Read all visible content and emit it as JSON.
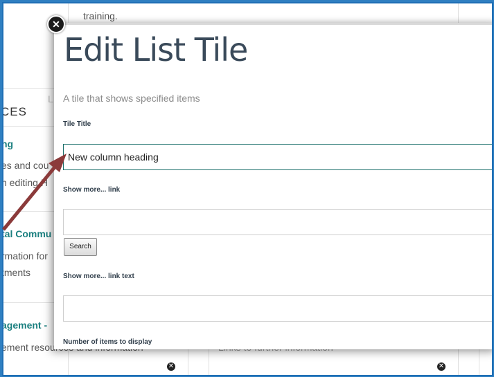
{
  "background": {
    "top_text": "training.",
    "section_heading": "CES",
    "link_1": "ng",
    "text_1": "es and cou",
    "text_2": "n editing H",
    "link_2": "tal Commu",
    "text_3": "rmation for",
    "text_4": "tments",
    "link_3": "agement - ",
    "text_5": "ement resources and information",
    "text_6": "Links to further information",
    "faint_char": "L"
  },
  "modal": {
    "close_icon": "close-icon",
    "title": "Edit List Tile",
    "description": "A tile that shows specified items",
    "fields": {
      "tile_title_label": "Tile Title",
      "tile_title_value": "New column heading",
      "show_more_link_label": "Show more... link",
      "show_more_link_value": "",
      "search_button": "Search",
      "show_more_link_text_label": "Show more... link text",
      "show_more_link_text_value": "",
      "number_of_items_label": "Number of items to display"
    }
  },
  "annotation": {
    "arrow_color": "#8b3a3a"
  }
}
